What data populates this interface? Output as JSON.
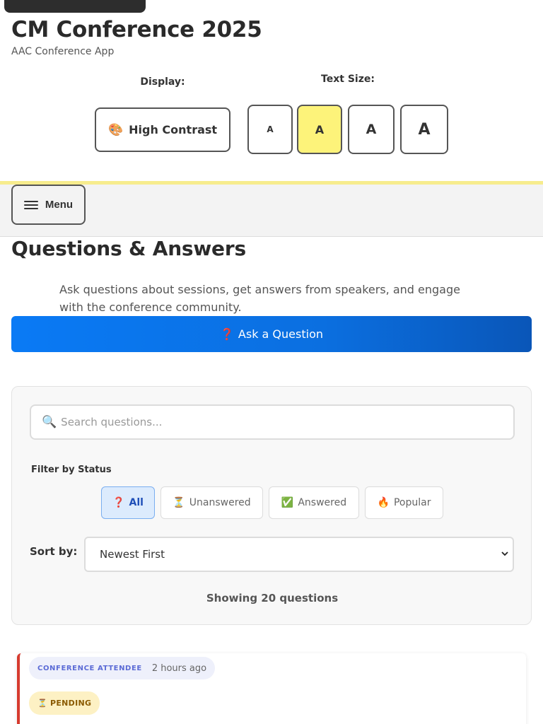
{
  "header": {
    "title": "CM Conference 2025",
    "subtitle": "AAC Conference App"
  },
  "accessibility": {
    "display_label": "Display:",
    "contrast_button": "High Contrast",
    "contrast_icon": "palette-icon",
    "text_size_label": "Text Size:",
    "text_sizes": [
      "A",
      "A",
      "A",
      "A"
    ],
    "active_text_size_index": 1
  },
  "nav": {
    "menu_label": "Menu",
    "menu_icon": "hamburger-icon"
  },
  "qa": {
    "title": "Questions & Answers",
    "intro": "Ask questions about sessions, get answers from speakers, and engage with the conference community.",
    "ask_button": "Ask a Question",
    "ask_icon": "❓"
  },
  "filters": {
    "search_placeholder": "Search questions...",
    "filter_label": "Filter by Status",
    "chips": [
      {
        "icon": "❓",
        "label": "All",
        "active": true
      },
      {
        "icon": "⏳",
        "label": "Unanswered",
        "active": false
      },
      {
        "icon": "✅",
        "label": "Answered",
        "active": false
      },
      {
        "icon": "🔥",
        "label": "Popular",
        "active": false
      }
    ],
    "sort_label": "Sort by:",
    "sort_value": "Newest First",
    "showing_text": "Showing 20 questions"
  },
  "questions": [
    {
      "author": "CONFERENCE ATTENDEE",
      "time": "2 hours ago",
      "status": "PENDING",
      "status_icon": "⏳"
    }
  ],
  "colors": {
    "accent_blue": "#0a7af5",
    "active_size_yellow": "#fdf37a",
    "pending_border": "#d63b2f"
  }
}
